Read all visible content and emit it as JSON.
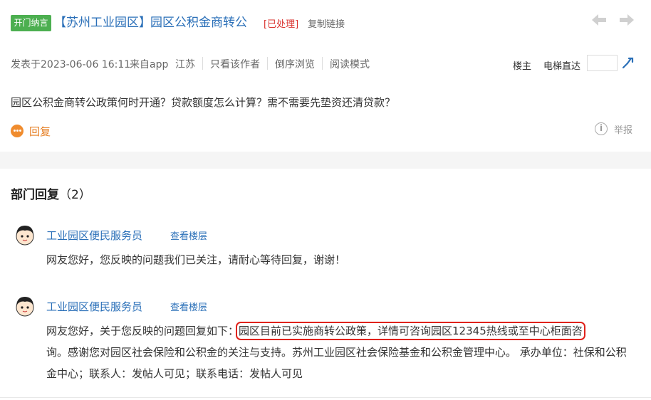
{
  "header": {
    "badge": "开门纳言",
    "area_tag": "【苏州工业园区】",
    "title": "园区公积金商转公",
    "status": "[已处理]",
    "copy_link": "复制链接"
  },
  "meta": {
    "posted": "发表于2023-06-06 16:11",
    "source": "来自app",
    "location": "江苏",
    "author_only": "只看该作者",
    "reverse": "倒序浏览",
    "read_mode": "阅读模式",
    "floor": "楼主",
    "elevator": "电梯直达"
  },
  "post": {
    "question": "园区公积金商转公政策何时开通？贷款额度怎么计算？需不需要先垫资还清贷款？",
    "reply": "回复",
    "report": "举报"
  },
  "replies_section": {
    "title": "部门回复",
    "count": "（2）"
  },
  "replies": [
    {
      "name": "工业园区便民服务员",
      "view_floor": "查看楼层",
      "text": "网友您好，您反映的问题我们已关注，请耐心等待回复，谢谢！"
    },
    {
      "name": "工业园区便民服务员",
      "view_floor": "查看楼层",
      "text_prefix": "网友您好，关于您反映的问题回复如下：",
      "text_highlight": "园区目前已实施商转公政策，详情可咨询园区12345热线或至中心柜面咨",
      "text_rest": "询。感谢您对园区社会保险和公积金的关注与支持。苏州工业园区社会保险基金和公积金管理中心。 承办单位：社保和公积金中心；联系人：发帖人可见；联系电话：发帖人可见"
    }
  ],
  "colors": {
    "link": "#2a6fb8",
    "status": "#d9302c",
    "badge": "#4caf50",
    "reply": "#e67e22",
    "highlight_border": "#e0221b"
  },
  "icons": [
    "arrow-left-icon",
    "arrow-right-icon",
    "jump-icon",
    "reply-bubble-icon",
    "info-icon",
    "avatar-icon"
  ]
}
